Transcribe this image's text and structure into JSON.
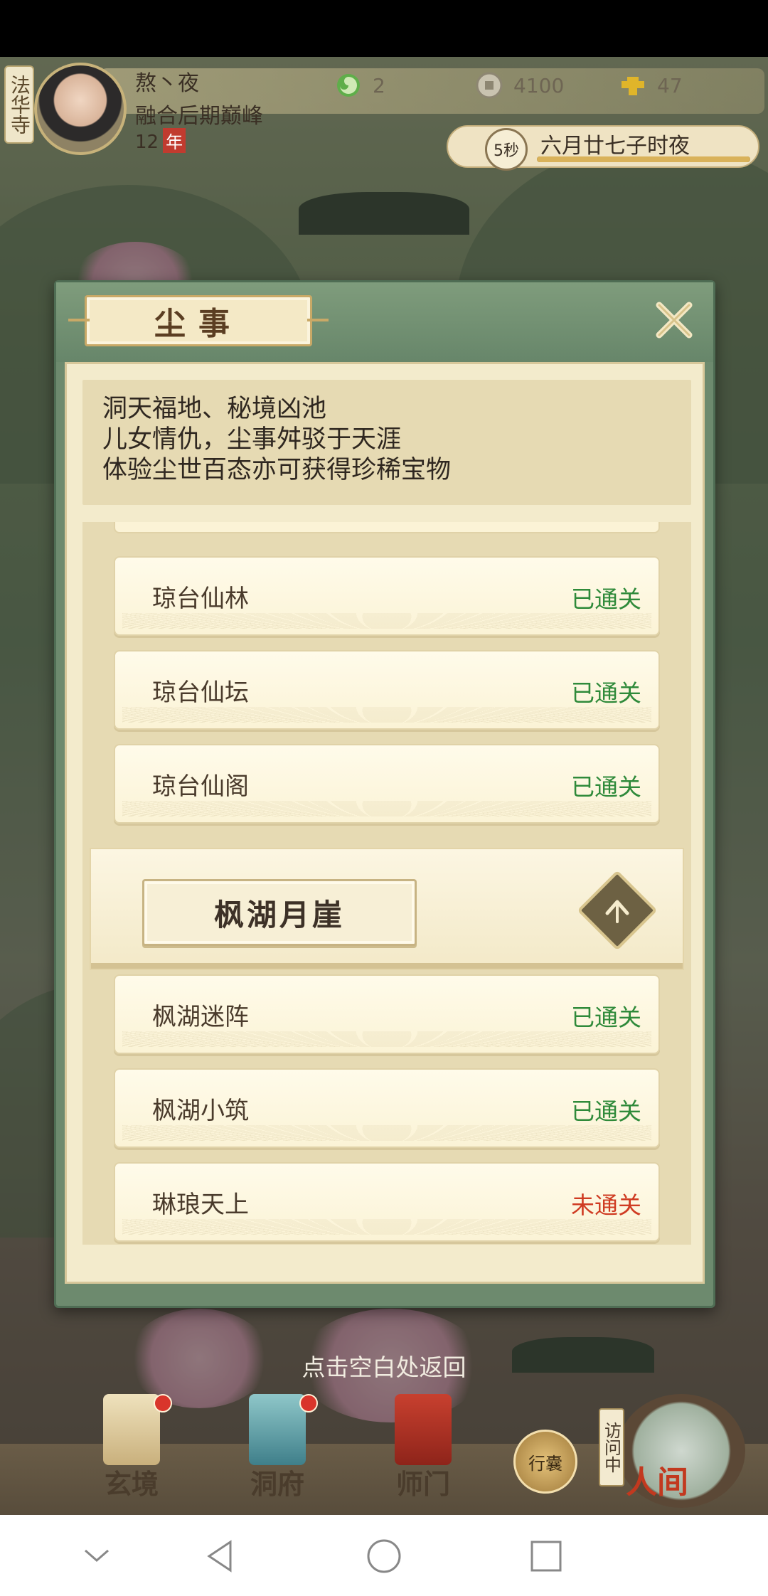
{
  "hud": {
    "location": "法华寺",
    "player_name": "熬丶夜",
    "realm": "融合后期巅峰",
    "age_value": "12",
    "age_unit": "年",
    "resources": [
      {
        "icon": "jade-swirl-icon",
        "value": "2"
      },
      {
        "icon": "coin-icon",
        "value": "4100"
      },
      {
        "icon": "strength-icon",
        "value": "47"
      }
    ],
    "timer_seconds": "5秒",
    "game_date": "六月廿七子时夜",
    "timer_progress": 1.0
  },
  "dialog": {
    "title": "尘事",
    "close_icon": "close-x-icon",
    "description": [
      "洞天福地、秘境凶池",
      "儿女情仇，尘事舛驳于天涯",
      "体验尘世百态亦可获得珍稀宝物"
    ],
    "stages_before": [
      {
        "name": "琼台仙林",
        "status": "已通关",
        "cleared": true
      },
      {
        "name": "琼台仙坛",
        "status": "已通关",
        "cleared": true
      },
      {
        "name": "琼台仙阁",
        "status": "已通关",
        "cleared": true
      }
    ],
    "group": {
      "name": "枫湖月崖",
      "toggle_icon": "collapse-up-icon"
    },
    "stages_after": [
      {
        "name": "枫湖迷阵",
        "status": "已通关",
        "cleared": true
      },
      {
        "name": "枫湖小筑",
        "status": "已通关",
        "cleared": true
      },
      {
        "name": "琳琅天上",
        "status": "未通关",
        "cleared": false
      }
    ]
  },
  "return_hint": "点击空白处返回",
  "bottom_nav": {
    "items": [
      {
        "label": "玄境",
        "icon": "scroll-icon",
        "badge": true
      },
      {
        "label": "洞府",
        "icon": "pavilion-icon",
        "badge": true
      },
      {
        "label": "师门",
        "icon": "banner-icon",
        "badge": false
      }
    ],
    "reward_label": "行囊",
    "visiting_label": "访问中",
    "world_label": "人间"
  },
  "colors": {
    "cleared": "#2f8a3a",
    "not_cleared": "#cf3b22",
    "dialog_green": "#6d8a6e",
    "paper": "#f3ebcc"
  },
  "system_nav": [
    "chevron-down-icon",
    "back-icon",
    "home-icon",
    "recents-icon"
  ]
}
